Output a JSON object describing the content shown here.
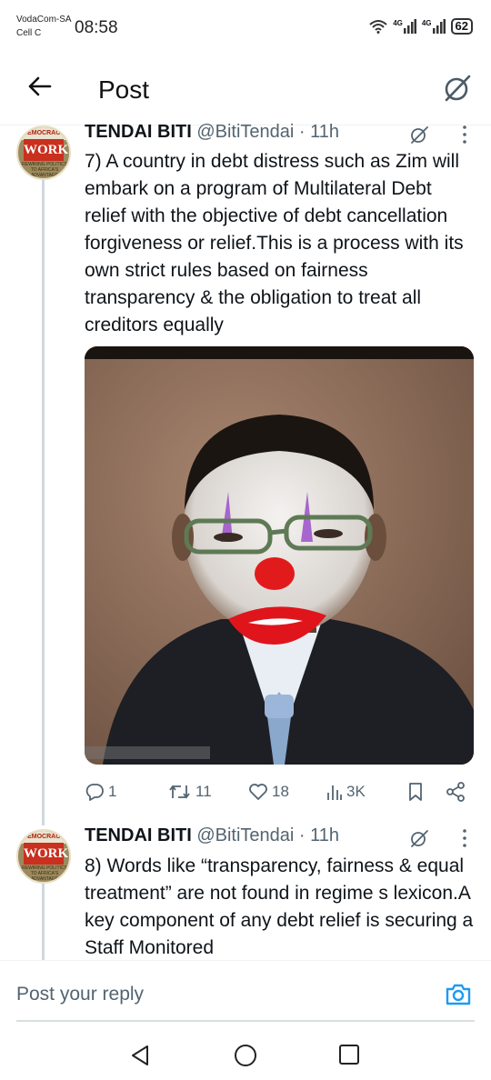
{
  "status_bar": {
    "carrier_1": "VodaCom-SA",
    "carrier_2": "Cell C",
    "time": "08:58",
    "network_1": "4G",
    "network_2": "4G",
    "battery": "62"
  },
  "header": {
    "title": "Post",
    "back_icon": "arrow-left-icon",
    "grok_icon": "grok-icon"
  },
  "tweets": [
    {
      "avatar_top": "DEMOCRACY",
      "avatar_main": "WORKS",
      "avatar_sub": "REWIRING POLITICS TO AFRICA'S ADVANTAGE",
      "name": "TENDAI BITI",
      "handle_time": "@BitiTendai · 11h",
      "text": "7) A country in debt distress such as Zim will embark on a program of Multilateral Debt relief with the objective of debt cancellation forgiveness or relief.This is a process with its own strict rules based on fairness transparency & the obligation to treat all creditors equally",
      "stats": {
        "replies": "1",
        "reposts": "11",
        "likes": "18",
        "views": "3K"
      }
    },
    {
      "avatar_top": "DEMOCRACY",
      "avatar_main": "WORKS",
      "avatar_sub": "REWIRING POLITICS TO AFRICA'S ADVANTAGE",
      "name": "TENDAI BITI",
      "handle_time": "@BitiTendai · 11h",
      "text": "8) Words like “transparency, fairness & equal treatment” are not found in regime s lexicon.A key component of any debt relief is securing a Staff Monitored"
    }
  ],
  "reply_bar": {
    "placeholder": "Post your reply"
  },
  "colors": {
    "text": "#0f1419",
    "secondary": "#536471",
    "accent": "#1d9bf0"
  }
}
